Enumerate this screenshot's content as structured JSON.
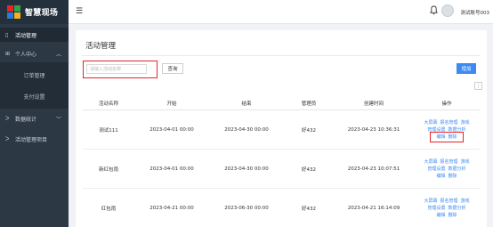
{
  "brand": {
    "name": "智慧现场",
    "logo_colors": [
      "#e8232b",
      "#2fa54a",
      "#2b7bd9",
      "#f2b21a"
    ]
  },
  "sidebar": {
    "items": [
      {
        "label": "活动管理",
        "icon": "doc-icon",
        "active": true
      },
      {
        "label": "个人中心",
        "icon": "grid-icon",
        "chevron": "︿"
      },
      {
        "label": "数据统计",
        "icon": "chart-icon",
        "chevron": "﹀"
      },
      {
        "label": "活动管理项目",
        "icon": "chart-icon"
      }
    ],
    "submenu": [
      {
        "label": "订单管理"
      },
      {
        "label": "支付设置"
      }
    ]
  },
  "topbar": {
    "menu_icon": "☰",
    "username": "测试账号003"
  },
  "main": {
    "title": "活动管理",
    "search": {
      "placeholder": "请输入活动名称",
      "value": ""
    },
    "query_label": "查询",
    "add_label": "增加",
    "tool_icon": "⋮"
  },
  "table": {
    "headers": [
      "活动名称",
      "开始",
      "结束",
      "管理员",
      "创建时间",
      "操作"
    ],
    "rows": [
      {
        "name": "测试111",
        "start": "2023-04-01 00:00",
        "end": "2023-04-30 00:00",
        "admin": "好432",
        "created": "2023-04-23 10:36:31",
        "ops": [
          [
            "大屏幕",
            "报名管理",
            "游戏"
          ],
          [
            "管理设置",
            "数据分析"
          ],
          [
            "编辑",
            "删除"
          ]
        ]
      },
      {
        "name": "新红包雨",
        "start": "2023-04-01 00:00",
        "end": "2023-04-30 00:00",
        "admin": "好432",
        "created": "2023-04-23 10:07:51",
        "ops": [
          [
            "大屏幕",
            "报名管理",
            "游戏"
          ],
          [
            "管理设置",
            "数据分析"
          ],
          [
            "编辑",
            "删除"
          ]
        ]
      },
      {
        "name": "红包雨",
        "start": "2023-04-21 00:00",
        "end": "2023-06-30 00:00",
        "admin": "好432",
        "created": "2023-04-21 16:14:09",
        "ops": [
          [
            "大屏幕",
            "报名管理",
            "游戏"
          ],
          [
            "管理设置",
            "数据分析"
          ],
          [
            "编辑",
            "删除"
          ]
        ]
      }
    ]
  },
  "colors": {
    "sidebar": "#2d3845",
    "accent": "#3d8bf2",
    "highlight": "#e8232b"
  }
}
